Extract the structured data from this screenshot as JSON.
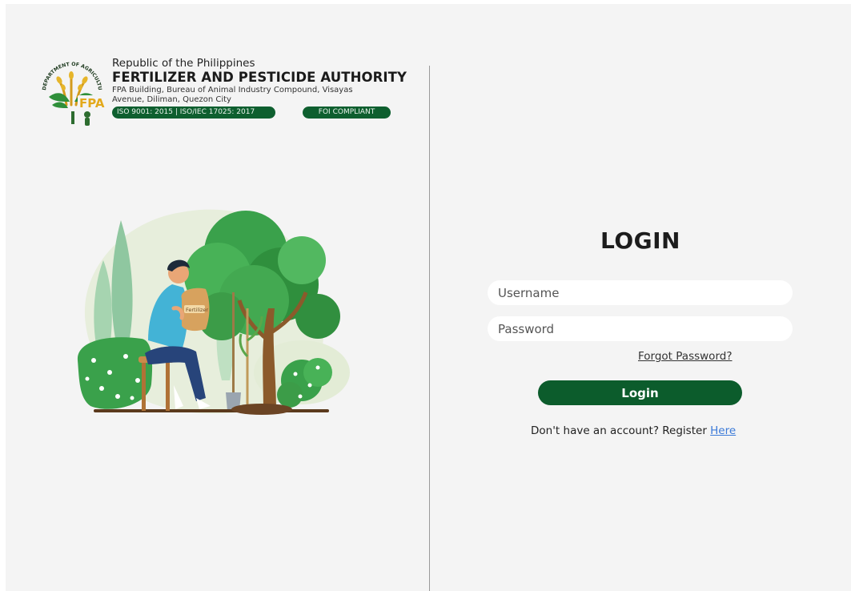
{
  "header": {
    "republic": "Republic of the Philippines",
    "agency": "FERTILIZER AND PESTICIDE AUTHORITY",
    "address_line1": "FPA Building, Bureau of Animal Industry Compound, Visayas",
    "address_line2": "Avenue, Diliman, Quezon City",
    "iso_badge": "ISO 9001: 2015 | ISO/IEC 17025: 2017",
    "foi_badge": "FOI COMPLIANT",
    "seal_text": "DEPARTMENT OF AGRICULTURE",
    "seal_abbrev": "FPA"
  },
  "illustration": {
    "bag_label": "Fertilizer"
  },
  "login": {
    "title": "LOGIN",
    "username_placeholder": "Username",
    "password_placeholder": "Password",
    "forgot_label": "Forgot Password?",
    "button_label": "Login",
    "register_prompt": "Don't have an account? Register ",
    "register_link": "Here"
  },
  "colors": {
    "brand_green": "#0c5c2c",
    "background": "#f4f4f4",
    "link_blue": "#3b7ad8"
  }
}
